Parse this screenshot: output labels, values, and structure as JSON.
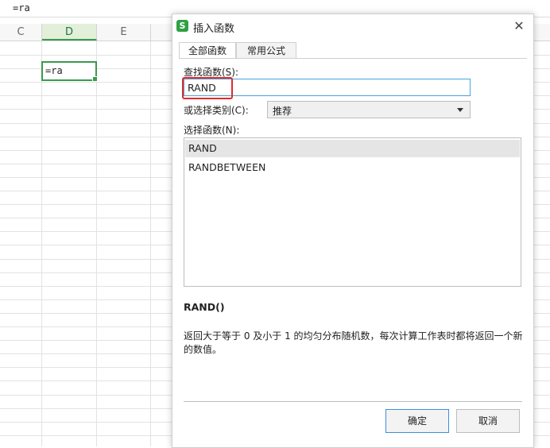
{
  "formula_bar": {
    "text": "=ra"
  },
  "columns": [
    {
      "label": "C"
    },
    {
      "label": "D"
    },
    {
      "label": "E"
    }
  ],
  "active_cell": {
    "column": "D",
    "text": "=ra"
  },
  "dialog": {
    "title": "插入函数",
    "close_label": "✕",
    "tabs": [
      {
        "label": "全部函数",
        "active": true
      },
      {
        "label": "常用公式",
        "active": false
      }
    ],
    "search_label": "查找函数(S):",
    "search_value": "RAND",
    "category_label": "或选择类别(C):",
    "category_value": "推荐",
    "functions_label": "选择函数(N):",
    "functions": [
      {
        "name": "RAND",
        "selected": true
      },
      {
        "name": "RANDBETWEEN",
        "selected": false
      }
    ],
    "signature": "RAND()",
    "description": "返回大于等于 0 及小于 1 的均匀分布随机数，每次计算工作表时都将返回一个新的数值。",
    "ok_label": "确定",
    "cancel_label": "取消"
  },
  "colors": {
    "accent_green": "#3c9a4d",
    "input_focus": "#4aa3df",
    "highlight_red": "#e02b2b"
  }
}
